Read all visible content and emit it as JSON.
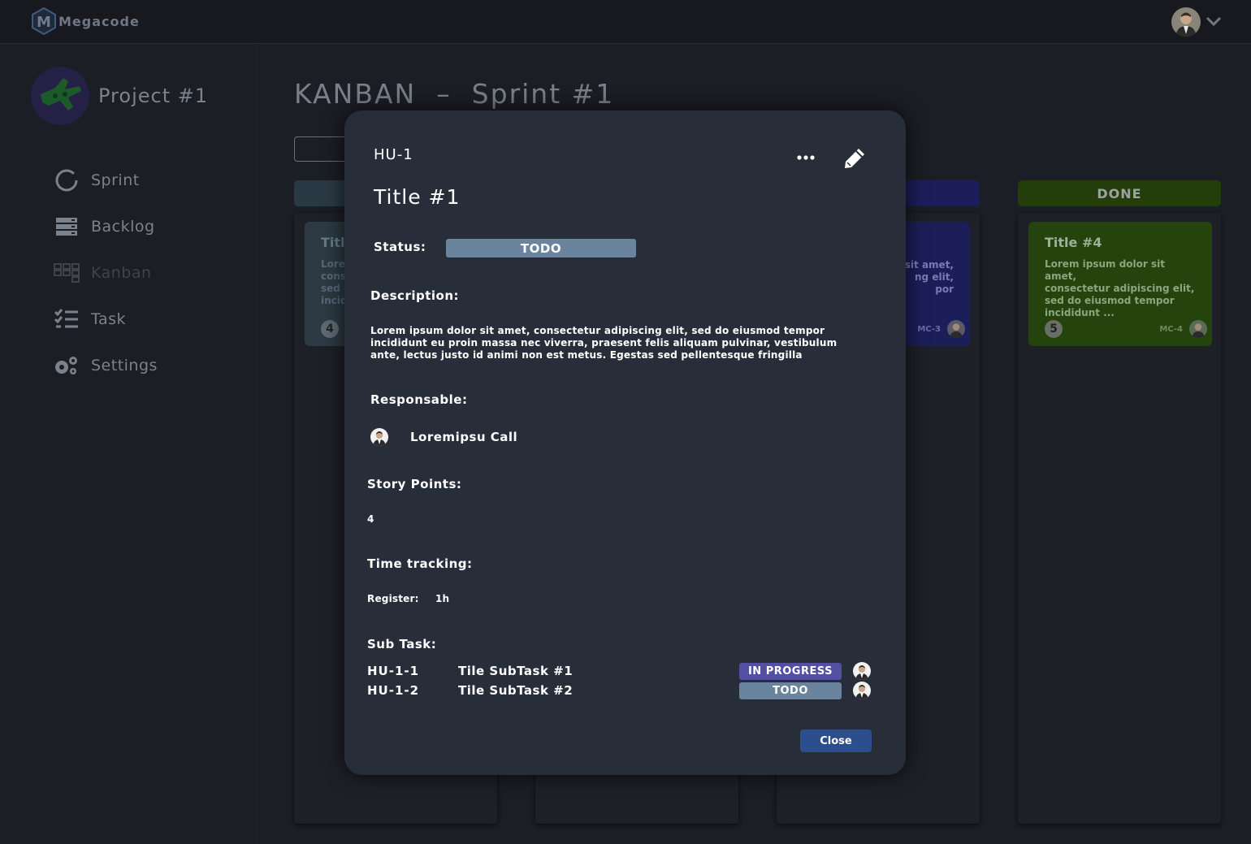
{
  "app": {
    "name": "Megacode",
    "logo_letter": "M"
  },
  "sidebar": {
    "project_name": "Project #1",
    "items": [
      {
        "label": "Sprint",
        "icon": "circle-icon"
      },
      {
        "label": "Backlog",
        "icon": "server-icon"
      },
      {
        "label": "Kanban",
        "icon": "kanban-icon",
        "active": true
      },
      {
        "label": "Task",
        "icon": "checklist-icon"
      },
      {
        "label": "Settings",
        "icon": "gears-icon"
      }
    ]
  },
  "main": {
    "title": "KANBAN  –  Sprint #1",
    "columns": [
      {
        "label": "",
        "color": "#2a3a44"
      },
      {
        "label": "",
        "color": "#2b2f37"
      },
      {
        "label": "",
        "color": "#1c1e5a"
      },
      {
        "label": "DONE",
        "color": "#233d0b"
      }
    ],
    "cards": [
      {
        "title": "Titl",
        "text": "Lorem\ncons\nsed d\nincid",
        "number": "4",
        "code": ""
      },
      {
        "title": "",
        "text": "sit amet,\nng elit,\npor",
        "number": "",
        "code": "MC-3"
      },
      {
        "title": "Title #4",
        "text": "Lorem ipsum dolor sit amet,\nconsectetur adipiscing elit,\nsed do eiusmod tempor\nincididunt ...",
        "number": "5",
        "code": "MC-4"
      }
    ]
  },
  "modal": {
    "key": "HU-1",
    "title": "Title #1",
    "status_label": "Status:",
    "status": "TODO",
    "description_label": "Description:",
    "description": "Lorem ipsum dolor sit amet, consectetur adipiscing elit, sed do eiusmod tempor incididunt eu proin massa nec viverra, praesent felis aliquam pulvinar, vestibulum ante, lectus justo id animi non est metus. Egestas sed pellentesque fringilla",
    "responsable_label": "Responsable:",
    "responsable_name": "Loremipsu Call",
    "story_points_label": "Story Points:",
    "story_points": "4",
    "time_tracking_label": "Time tracking:",
    "register_label": "Register:",
    "register_value": "1h",
    "subtask_label": "Sub Task:",
    "subtasks": [
      {
        "code": "HU-1-1",
        "title": "Tile SubTask #1",
        "status": "IN PROGRESS",
        "status_color": "#5350a3"
      },
      {
        "code": "HU-1-2",
        "title": "Tile SubTask #2",
        "status": "TODO",
        "status_color": "#6b849d"
      }
    ],
    "close_label": "Close"
  },
  "colors": {
    "status_todo": "#6b849d",
    "status_in_progress": "#5350a3",
    "close_button": "#2d4e8c",
    "modal_bg": "#282e39"
  }
}
